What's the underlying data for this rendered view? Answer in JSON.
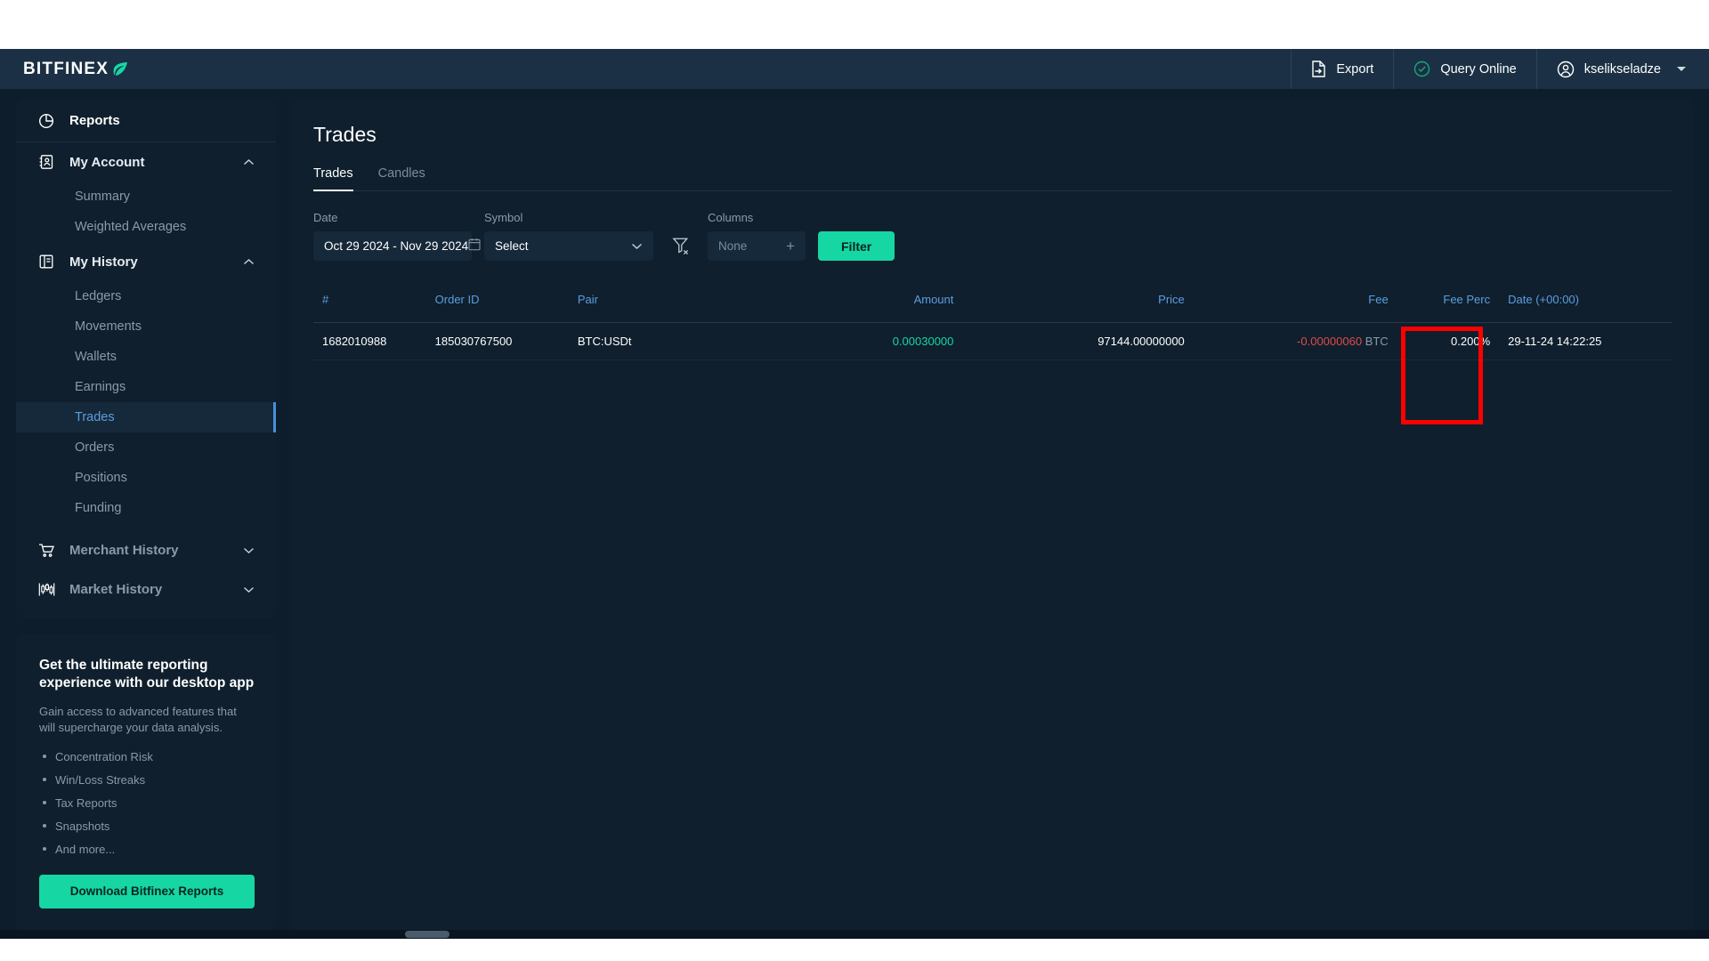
{
  "header": {
    "brand": "BITFINEX",
    "brand_icon": "leaf-icon",
    "export_label": "Export",
    "export_icon": "file-export-icon",
    "query_label": "Query Online",
    "query_icon": "check-circle-icon",
    "user_label": "kselikseladze",
    "user_icon": "user-circle-icon"
  },
  "sidebar": {
    "reports_label": "Reports",
    "groups": [
      {
        "label": "My Account",
        "icon": "account-card-icon",
        "expanded": true,
        "items": [
          {
            "label": "Summary",
            "active": false
          },
          {
            "label": "Weighted Averages",
            "active": false
          }
        ]
      },
      {
        "label": "My History",
        "icon": "book-icon",
        "expanded": true,
        "items": [
          {
            "label": "Ledgers",
            "active": false
          },
          {
            "label": "Movements",
            "active": false
          },
          {
            "label": "Wallets",
            "active": false
          },
          {
            "label": "Earnings",
            "active": false
          },
          {
            "label": "Trades",
            "active": true
          },
          {
            "label": "Orders",
            "active": false
          },
          {
            "label": "Positions",
            "active": false
          },
          {
            "label": "Funding",
            "active": false
          }
        ]
      },
      {
        "label": "Merchant History",
        "icon": "cart-icon",
        "expanded": false,
        "items": []
      },
      {
        "label": "Market History",
        "icon": "candlestick-icon",
        "expanded": false,
        "items": []
      }
    ]
  },
  "promo": {
    "title": "Get the ultimate reporting experience with our desktop app",
    "subtitle": "Gain access to advanced features that will supercharge your data analysis.",
    "features": [
      "Concentration Risk",
      "Win/Loss Streaks",
      "Tax Reports",
      "Snapshots",
      "And more..."
    ],
    "button_label": "Download Bitfinex Reports"
  },
  "main": {
    "page_title": "Trades",
    "tabs": [
      {
        "label": "Trades",
        "active": true
      },
      {
        "label": "Candles",
        "active": false
      }
    ],
    "filters": {
      "date_label": "Date",
      "date_value": "Oct 29 2024 - Nov 29 2024",
      "date_icon": "calendar-icon",
      "symbol_label": "Symbol",
      "symbol_value": "Select",
      "symbol_icon": "chevron-down-icon",
      "clear_filter_icon": "filter-clear-icon",
      "columns_label": "Columns",
      "columns_value": "None",
      "columns_icon": "plus-icon",
      "filter_button": "Filter"
    },
    "table": {
      "columns": [
        "#",
        "Order ID",
        "Pair",
        "Amount",
        "Price",
        "Fee",
        "Fee Perc",
        "Date (+00:00)"
      ],
      "rows": [
        {
          "num": "1682010988",
          "order_id": "185030767500",
          "pair": "BTC:USDt",
          "amount": "0.00030000",
          "price": "97144.00000000",
          "fee": "-0.00000060",
          "fee_unit": "BTC",
          "fee_perc": "0.200%",
          "date": "29-11-24 14:22:25"
        }
      ]
    },
    "annotation": {
      "color": "#ff0000",
      "target": "Fee Perc"
    }
  },
  "colors": {
    "accent_green": "#16d6a4",
    "accent_blue": "#5b9de0",
    "negative_red": "#e04a4a",
    "panel_bg": "#0f1f2d",
    "app_bg": "#0d1d2b",
    "topbar_bg": "#1b3044"
  }
}
